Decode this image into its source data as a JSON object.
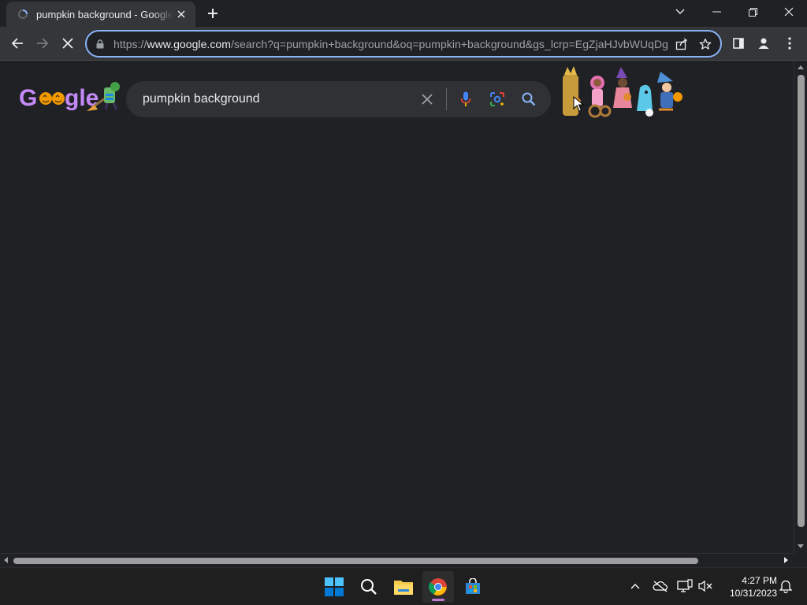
{
  "browser": {
    "tab": {
      "title": "pumpkin background - Google Search",
      "favicon": "loading-spinner-icon"
    },
    "omnibox": {
      "scheme": "https://",
      "host": "www.google.com",
      "path": "/search?q=pumpkin+background&oq=pumpkin+background&gs_lcrp=EgZjaHJvbWUqDg"
    },
    "icons": [
      "back-icon",
      "forward-icon",
      "stop-icon",
      "lock-icon",
      "share-icon",
      "star-icon",
      "side-panel-icon",
      "profile-icon",
      "menu-icon",
      "minimize-icon",
      "restore-icon",
      "close-icon",
      "tab-search-icon",
      "new-tab-icon"
    ]
  },
  "page": {
    "logo_text": "Google",
    "search": {
      "query": "pumpkin background"
    },
    "doodle": "halloween-doodle"
  },
  "taskbar": {
    "apps": [
      "start-icon",
      "search-icon",
      "file-explorer-icon",
      "chrome-icon",
      "store-icon"
    ],
    "clock": {
      "time": "4:27 PM",
      "date": "10/31/2023"
    }
  },
  "colors": {
    "page_bg": "#202124",
    "chrome_bg": "#35363a",
    "focus_ring": "#8ab4f8",
    "text": "#e8eaed",
    "muted": "#9aa0a6"
  }
}
